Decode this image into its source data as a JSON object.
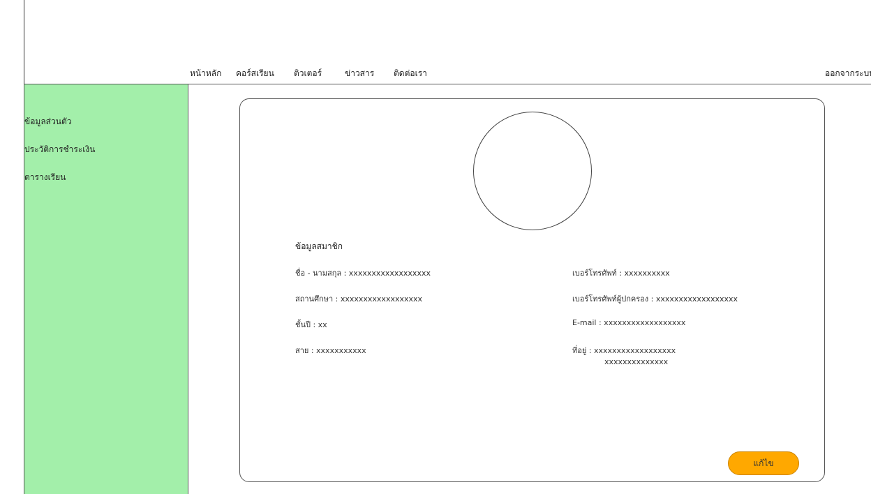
{
  "nav": {
    "items": [
      {
        "label": "หน้าหลัก"
      },
      {
        "label": "คอร์สเรียน"
      },
      {
        "label": "ติวเตอร์"
      },
      {
        "label": "ข่าวสาร"
      },
      {
        "label": "ติดต่อเรา"
      }
    ],
    "logout_label": "ออกจากระบบ"
  },
  "sidebar": {
    "items": [
      {
        "label": "ข้อมูลส่วนตัว"
      },
      {
        "label": "ประวัติการชำระเงิน"
      },
      {
        "label": "ตารางเรียน"
      }
    ],
    "background": "#a3efaa"
  },
  "profile": {
    "section_title": "ข้อมูลสมาชิก",
    "left_fields": [
      {
        "text": "ชื่อ - นามสกุล : xxxxxxxxxxxxxxxxxx"
      },
      {
        "text": "สถานศึกษา : xxxxxxxxxxxxxxxxxx"
      },
      {
        "text": "ชั้นปี : xx"
      },
      {
        "text": "สาย : xxxxxxxxxxx"
      }
    ],
    "right_fields": [
      {
        "text": "เบอร์โทรศัพท์ : xxxxxxxxxx"
      },
      {
        "text": "เบอร์โทรศัพท์ผู้ปกครอง : xxxxxxxxxxxxxxxxxx"
      },
      {
        "text": "E-mail : xxxxxxxxxxxxxxxxxx"
      },
      {
        "text": "ที่อยู่ : xxxxxxxxxxxxxxxxxx"
      }
    ],
    "address_line2": "xxxxxxxxxxxxxx",
    "edit_label": "แก้ไข",
    "accent": "#ffa800"
  }
}
